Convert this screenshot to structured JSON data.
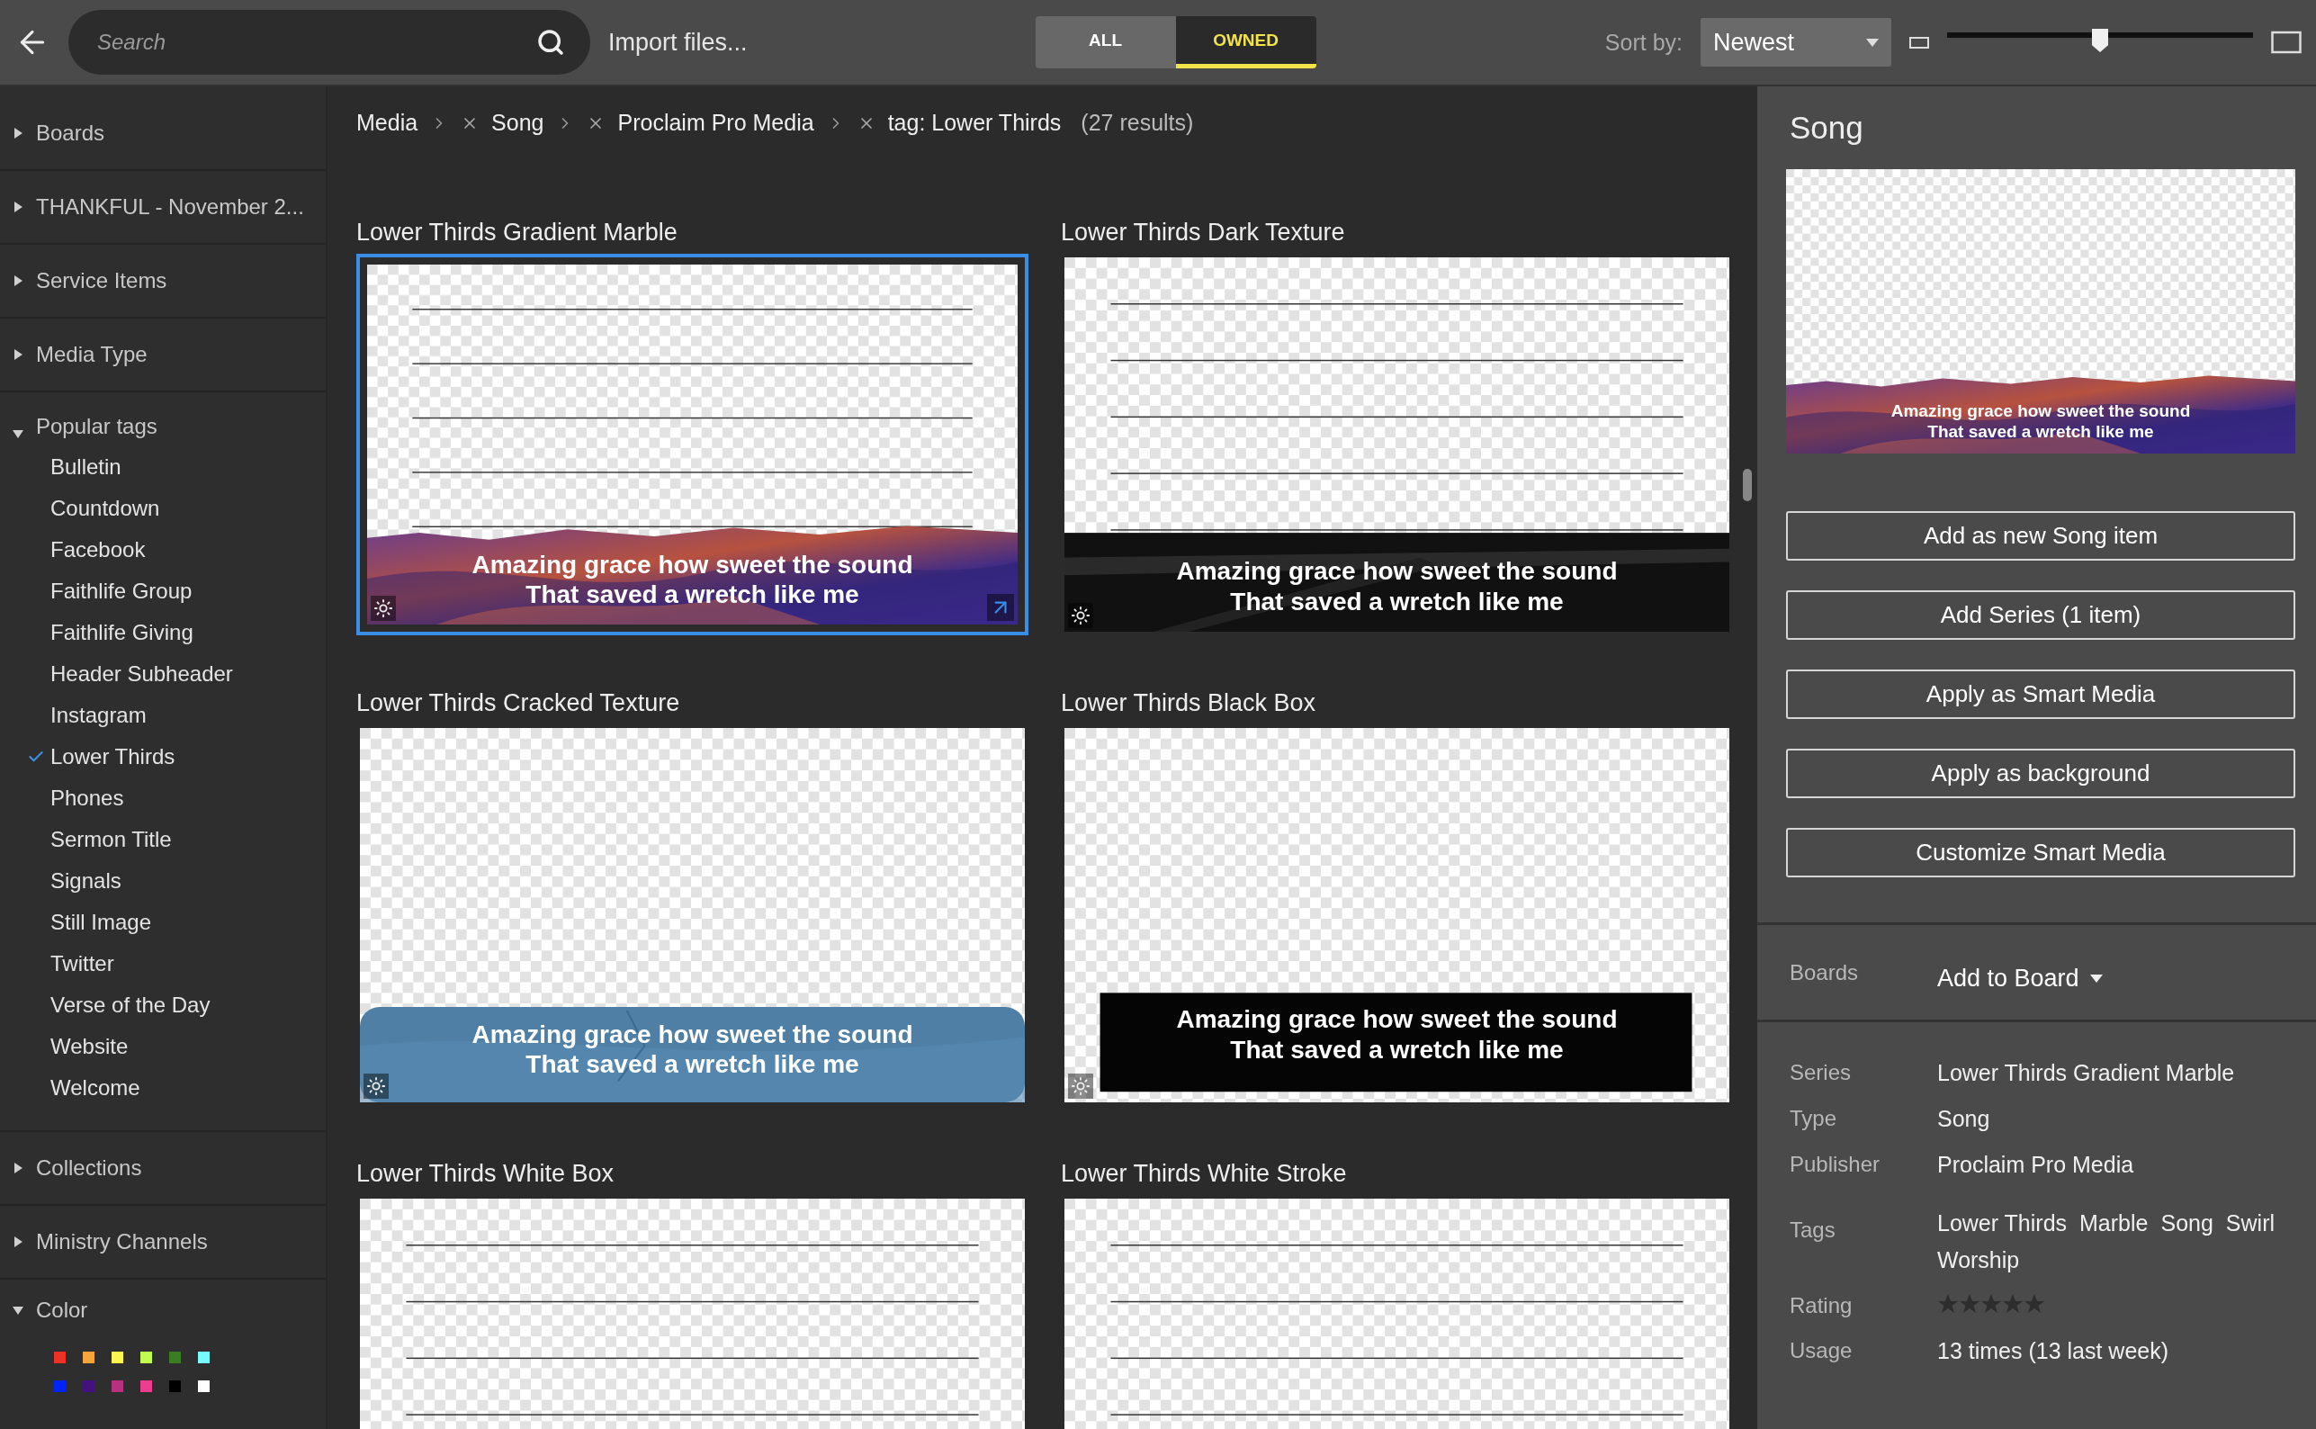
{
  "toolbar": {
    "search": {
      "placeholder": "Search"
    },
    "import_label": "Import files...",
    "filter_tabs": [
      {
        "label": "ALL",
        "selected": false
      },
      {
        "label": "OWNED",
        "selected": true
      }
    ],
    "sort_label": "Sort by:",
    "sort_value": "Newest",
    "size_slider": {
      "level": 0.5
    }
  },
  "sidebar": {
    "sections_top": [
      {
        "label": "Boards",
        "expanded": false
      },
      {
        "label": "THANKFUL - November 2...",
        "expanded": false
      },
      {
        "label": "Service Items",
        "expanded": false
      },
      {
        "label": "Media Type",
        "expanded": false
      }
    ],
    "popular_tags": {
      "label": "Popular tags",
      "expanded": true,
      "items": [
        {
          "label": "Bulletin",
          "selected": false
        },
        {
          "label": "Countdown",
          "selected": false
        },
        {
          "label": "Facebook",
          "selected": false
        },
        {
          "label": "Faithlife Group",
          "selected": false
        },
        {
          "label": "Faithlife Giving",
          "selected": false
        },
        {
          "label": "Header Subheader",
          "selected": false
        },
        {
          "label": "Instagram",
          "selected": false
        },
        {
          "label": "Lower Thirds",
          "selected": true
        },
        {
          "label": "Phones",
          "selected": false
        },
        {
          "label": "Sermon Title",
          "selected": false
        },
        {
          "label": "Signals",
          "selected": false
        },
        {
          "label": "Still Image",
          "selected": false
        },
        {
          "label": "Twitter",
          "selected": false
        },
        {
          "label": "Verse of the Day",
          "selected": false
        },
        {
          "label": "Website",
          "selected": false
        },
        {
          "label": "Welcome",
          "selected": false
        }
      ]
    },
    "sections_bottom": [
      {
        "label": "Collections",
        "expanded": false
      },
      {
        "label": "Ministry Channels",
        "expanded": false
      }
    ],
    "color_section": {
      "label": "Color",
      "expanded": true,
      "swatches": [
        {
          "color": "#ee3226"
        },
        {
          "color": "#f4a63c"
        },
        {
          "color": "#fdf850"
        },
        {
          "color": "#c2fc50"
        },
        {
          "color": "#3a7d22"
        },
        {
          "color": "#76fcfd"
        },
        {
          "color": "#0022fb"
        },
        {
          "color": "#43127e"
        },
        {
          "color": "#b7317f"
        },
        {
          "color": "#ec3d8f"
        },
        {
          "color": "#000000"
        },
        {
          "color": "#ffffff"
        }
      ]
    }
  },
  "breadcrumb": {
    "items": [
      {
        "label": "Media",
        "removable": false
      },
      {
        "label": "Song",
        "removable": true
      },
      {
        "label": "Proclaim Pro Media",
        "removable": true
      },
      {
        "label": "tag: Lower Thirds",
        "removable": true
      }
    ],
    "results": "(27 results)"
  },
  "cards": [
    {
      "title": "Lower Thirds Gradient Marble",
      "kind": "marble",
      "selected": true,
      "lyrics": [
        "Amazing grace how sweet the sound",
        "That saved a wretch like me"
      ]
    },
    {
      "title": "Lower Thirds Dark Texture",
      "kind": "dark",
      "selected": false,
      "lyrics": [
        "Amazing grace how sweet the sound",
        "That saved a wretch like me"
      ]
    },
    {
      "title": "Lower Thirds Cracked Texture",
      "kind": "cracked",
      "selected": false,
      "lyrics": [
        "Amazing grace how sweet the sound",
        "That saved a wretch like me"
      ]
    },
    {
      "title": "Lower Thirds Black Box",
      "kind": "black-box",
      "selected": false,
      "lyrics": [
        "Amazing grace how sweet the sound",
        "That saved a wretch like me"
      ]
    },
    {
      "title": "Lower Thirds White Box",
      "kind": "plain",
      "selected": false
    },
    {
      "title": "Lower Thirds White Stroke",
      "kind": "plain",
      "selected": false
    }
  ],
  "details": {
    "title": "Song",
    "preview": {
      "kind": "marble",
      "lyrics": [
        "Amazing grace how sweet the sound",
        "That saved a wretch like me"
      ]
    },
    "actions": [
      "Add as new Song item",
      "Add Series (1 item)",
      "Apply as Smart Media",
      "Apply as background",
      "Customize Smart Media"
    ],
    "boards": {
      "label": "Boards",
      "value": "Add to Board"
    },
    "properties": [
      {
        "label": "Series",
        "value": "Lower Thirds Gradient Marble"
      },
      {
        "label": "Type",
        "value": "Song"
      },
      {
        "label": "Publisher",
        "value": "Proclaim Pro Media"
      }
    ],
    "tags": {
      "label": "Tags",
      "items": [
        "Lower Thirds",
        "Marble",
        "Song",
        "Swirl",
        "Worship"
      ]
    },
    "rating": {
      "label": "Rating",
      "stars": 0
    },
    "usage": {
      "label": "Usage",
      "value": "13 times (13 last week)"
    }
  }
}
